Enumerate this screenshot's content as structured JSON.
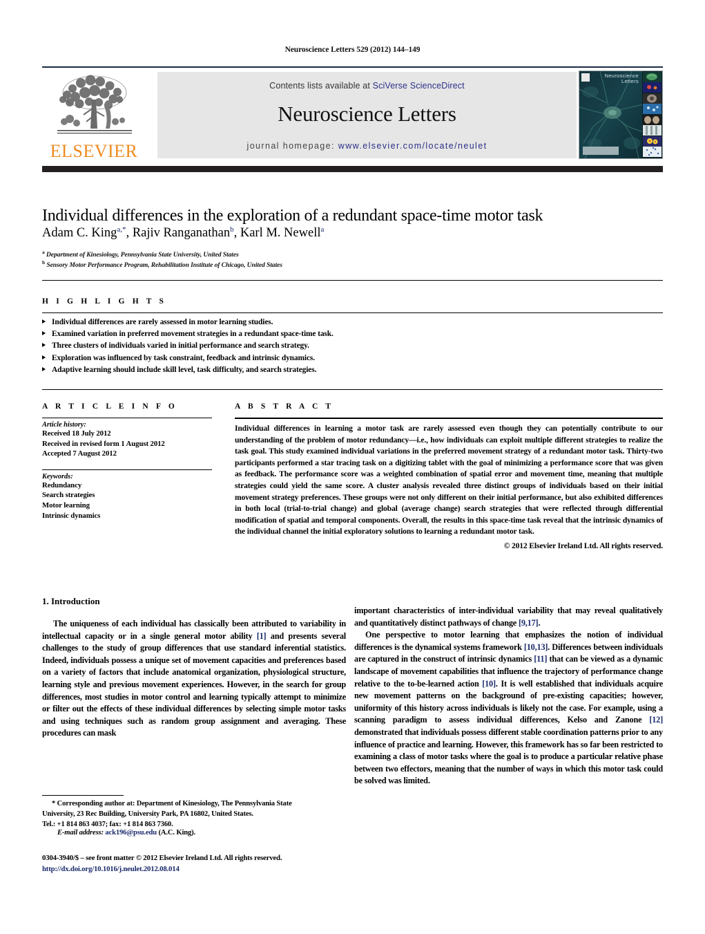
{
  "running_head": "Neuroscience Letters 529 (2012) 144–149",
  "masthead": {
    "contents_prefix": "Contents lists available at ",
    "sciencedirect_link": "SciVerse ScienceDirect",
    "journal_title": "Neuroscience Letters",
    "homepage_prefix": "journal homepage: ",
    "homepage_url": "www.elsevier.com/locate/neulet",
    "publisher_logo_text": "ELSEVIER",
    "cover_journal_name": "Neuroscience Letters",
    "link_color": "#2b2f87",
    "elsevier_orange": "#ee8b22",
    "banner_bg": "#e6e6e6",
    "rule_dark": "#231f20"
  },
  "article": {
    "title": "Individual differences in the exploration of a redundant space-time motor task",
    "authors_html": "Adam C. King<sup>a,*</sup>, Rajiv Ranganathan<sup>b</sup>, Karl M. Newell<sup>a</sup>",
    "affiliation_a": "Department of Kinesiology, Pennsylvania State University, United States",
    "affiliation_b": "Sensory Motor Performance Program, Rehabilitation Institute of Chicago, United States",
    "affil_marker_a": "a",
    "affil_marker_b": "b"
  },
  "highlights": {
    "label": "H I G H L I G H T S",
    "items": [
      "Individual differences are rarely assessed in motor learning studies.",
      "Examined variation in preferred movement strategies in a redundant space-time task.",
      "Three clusters of individuals varied in initial performance and search strategy.",
      "Exploration was influenced by task constraint, feedback and intrinsic dynamics.",
      "Adaptive learning should include skill level, task difficulty, and search strategies."
    ]
  },
  "article_info": {
    "label": "A R T I C L E    I N F O",
    "history_heading": "Article history:",
    "history_lines": [
      "Received 18 July 2012",
      "Received in revised form 1 August 2012",
      "Accepted 7 August 2012"
    ],
    "keywords_heading": "Keywords:",
    "keywords": [
      "Redundancy",
      "Search strategies",
      "Motor learning",
      "Intrinsic dynamics"
    ]
  },
  "abstract": {
    "label": "A B S T R A C T",
    "text": "Individual differences in learning a motor task are rarely assessed even though they can potentially contribute to our understanding of the problem of motor redundancy—i.e., how individuals can exploit multiple different strategies to realize the task goal. This study examined individual variations in the preferred movement strategy of a redundant motor task. Thirty-two participants performed a star tracing task on a digitizing tablet with the goal of minimizing a performance score that was given as feedback. The performance score was a weighted combination of spatial error and movement time, meaning that multiple strategies could yield the same score. A cluster analysis revealed three distinct groups of individuals based on their initial movement strategy preferences. These groups were not only different on their initial performance, but also exhibited differences in both local (trial-to-trial change) and global (average change) search strategies that were reflected through differential modification of spatial and temporal components. Overall, the results in this space-time task reveal that the intrinsic dynamics of the individual channel the initial exploratory solutions to learning a redundant motor task.",
    "copyright": "© 2012 Elsevier Ireland Ltd. All rights reserved."
  },
  "body": {
    "section_number_title": "1.  Introduction",
    "left_p1_a": "The uniqueness of each individual has classically been attributed to variability in intellectual capacity or in a single general motor ability ",
    "left_p1_ref": "[1]",
    "left_p1_b": " and presents several challenges to the study of group differences that use standard inferential statistics. Indeed, individuals possess a unique set of movement capacities and preferences based on a variety of factors that include anatomical organization, physiological structure, learning style and previous movement experiences. However, in the search for group differences, most studies in motor control and learning typically attempt to minimize or filter out the effects of these individual differences by selecting simple motor tasks and using techniques such as random group assignment and averaging. These procedures can mask",
    "right_p1_a": "important characteristics of inter-individual variability that may reveal qualitatively and quantitatively distinct pathways of change ",
    "right_p1_ref": "[9,17]",
    "right_p1_b": ".",
    "right_p2_a": "One perspective to motor learning that emphasizes the notion of individual differences is the dynamical systems framework ",
    "right_p2_ref1": "[10,13]",
    "right_p2_b": ". Differences between individuals are captured in the construct of intrinsic dynamics ",
    "right_p2_ref2": "[11]",
    "right_p2_c": " that can be viewed as a dynamic landscape of movement capabilities that influence the trajectory of performance change relative to the to-be-learned action ",
    "right_p2_ref3": "[10]",
    "right_p2_d": ". It is well established that individuals acquire new movement patterns on the background of pre-existing capacities; however, uniformity of this history across individuals is likely not the case. For example, using a scanning paradigm to assess individual differences, Kelso and Zanone ",
    "right_p2_ref4": "[12]",
    "right_p2_e": " demonstrated that individuals possess different stable coordination patterns prior to any influence of practice and learning. However, this framework has so far been restricted to examining a class of motor tasks where the goal is to produce a particular relative phase between two effectors, meaning that the number of ways in which this motor task could be solved was limited."
  },
  "footnotes": {
    "corresponding_line1": "* Corresponding author at: Department of Kinesiology, The Pennsylvania State",
    "corresponding_line2": "University, 23 Rec Building, University Park, PA 16802, United States.",
    "corresponding_line3": "Tel.: +1 814 863 4037; fax: +1 814 863 7360.",
    "email_label": "E-mail address:",
    "email_value": "ack196@psu.edu",
    "email_owner": "(A.C. King).",
    "issn_line": "0304-3940/$ – see front matter © 2012 Elsevier Ireland Ltd. All rights reserved.",
    "doi_line": "http://dx.doi.org/10.1016/j.neulet.2012.08.014"
  }
}
